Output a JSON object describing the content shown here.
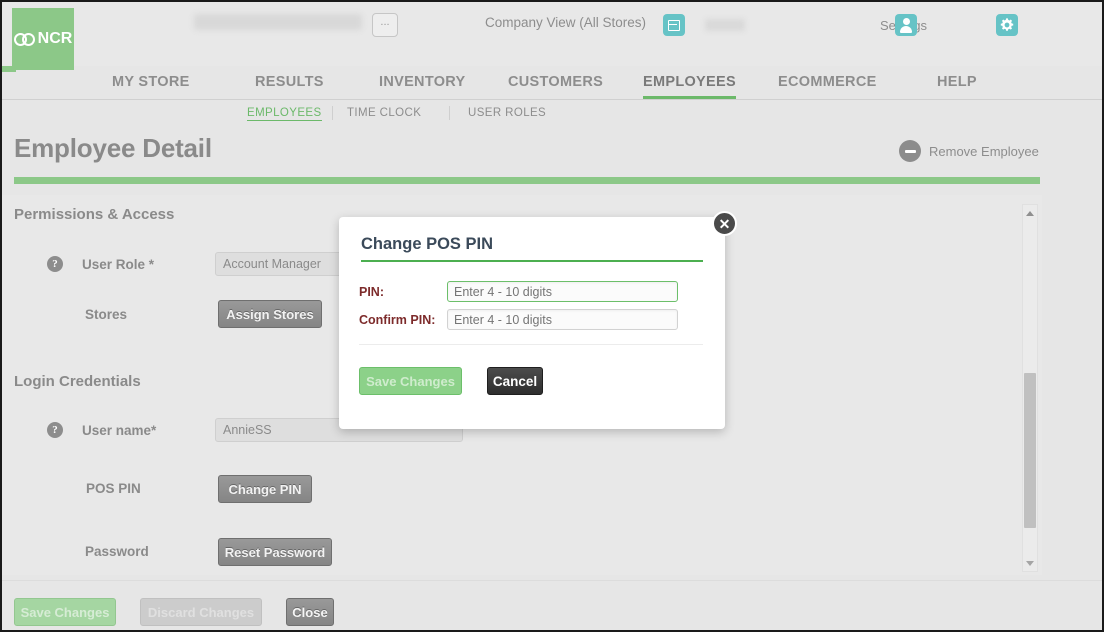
{
  "header": {
    "logo_text": "NCR",
    "logo_icon": "ncr-interlocking-rings-logo",
    "store_name_redacted": "",
    "ellipsis_label": "...",
    "company_view_label": "Company View (All Stores)",
    "store_icon": "store-register-icon",
    "store_sub_redacted": "",
    "user_icon": "user-avatar-icon",
    "settings_label": "Settings",
    "gear_icon": "gear-icon"
  },
  "main_nav": {
    "items": [
      {
        "label": "MY STORE",
        "active": false
      },
      {
        "label": "RESULTS",
        "active": false
      },
      {
        "label": "INVENTORY",
        "active": false
      },
      {
        "label": "CUSTOMERS",
        "active": false
      },
      {
        "label": "EMPLOYEES",
        "active": true
      },
      {
        "label": "ECOMMERCE",
        "active": false
      },
      {
        "label": "HELP",
        "active": false
      }
    ],
    "accent_color": "#8cc888"
  },
  "sub_nav": {
    "items": [
      {
        "label": "EMPLOYEES",
        "active": true
      },
      {
        "label": "TIME CLOCK",
        "active": false
      },
      {
        "label": "USER ROLES",
        "active": false
      }
    ]
  },
  "page": {
    "title": "Employee Detail",
    "remove_employee_label": "Remove Employee",
    "remove_icon": "minus-circle-icon",
    "rule_color": "#8cc888"
  },
  "sections": {
    "permissions": {
      "heading": "Permissions & Access",
      "user_role": {
        "help_icon": "help-question-icon",
        "label": "User Role *",
        "value": "Account Manager"
      },
      "stores": {
        "label": "Stores",
        "button_label": "Assign Stores"
      }
    },
    "login": {
      "heading": "Login Credentials",
      "user_name": {
        "help_icon": "help-question-icon",
        "label": "User name*",
        "value": "AnnieSS"
      },
      "pos_pin": {
        "label": "POS PIN",
        "button_label": "Change PIN"
      },
      "password": {
        "label": "Password",
        "button_label": "Reset Password"
      }
    }
  },
  "modal": {
    "title": "Change POS PIN",
    "close_icon": "close-x-circle-icon",
    "title_rule_color": "#4caf50",
    "fields": [
      {
        "label": "PIN:",
        "value": "",
        "placeholder": "Enter 4 - 10 digits",
        "focused": true
      },
      {
        "label": "Confirm PIN:",
        "value": "",
        "placeholder": "Enter 4 - 10 digits",
        "focused": false
      }
    ],
    "save_label": "Save Changes",
    "cancel_label": "Cancel",
    "label_color": "#7d2b2b"
  },
  "scrollbar": {
    "up_icon": "scroll-up-arrow-icon",
    "down_icon": "scroll-down-arrow-icon"
  },
  "footer": {
    "save_label": "Save Changes",
    "discard_label": "Discard Changes",
    "close_label": "Close"
  }
}
